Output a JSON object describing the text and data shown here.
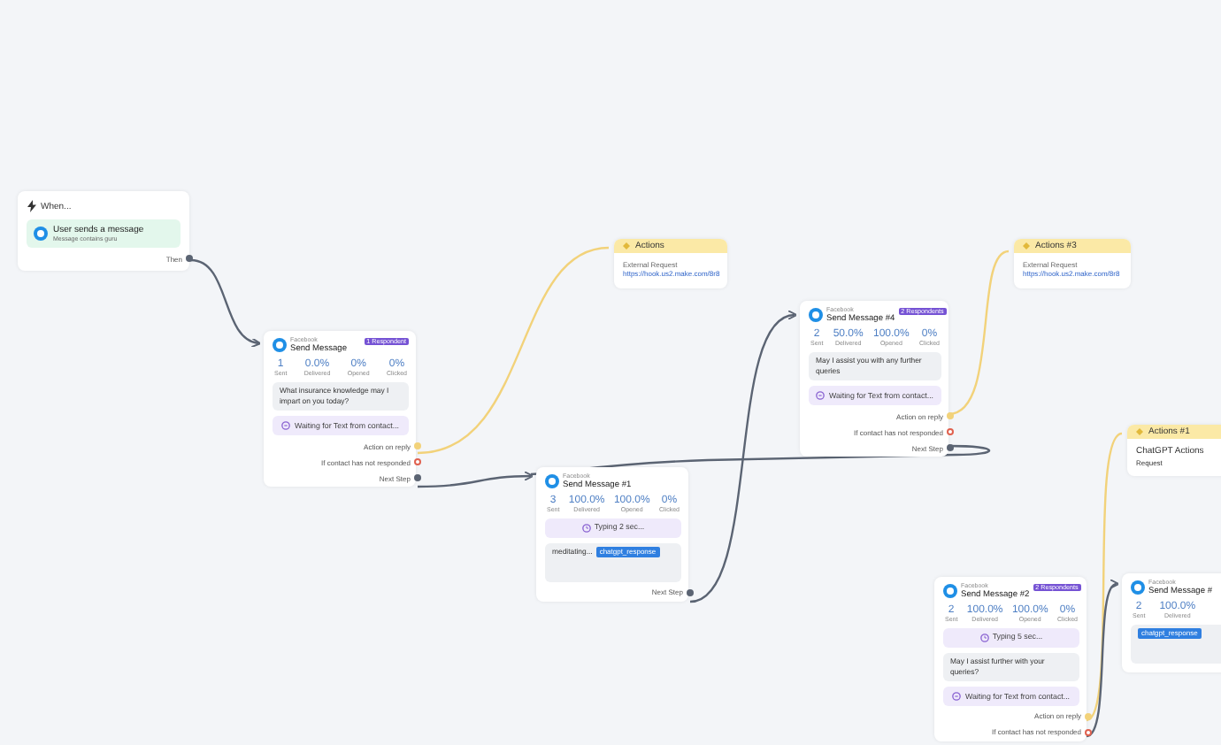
{
  "nodes": [
    {
      "kind": "trigger",
      "title": "When...",
      "trigger": {
        "title": "User sends a message",
        "subtitle": "Message contains guru"
      },
      "ports": [
        {
          "kind": "next",
          "label": "Then"
        }
      ]
    },
    {
      "kind": "message",
      "channel": "Facebook",
      "title": "Send Message",
      "badge": "1 Respondent",
      "stats": [
        {
          "value": "1",
          "label": "Sent"
        },
        {
          "value": "0.0%",
          "label": "Delivered"
        },
        {
          "value": "0%",
          "label": "Opened"
        },
        {
          "value": "0%",
          "label": "Clicked"
        }
      ],
      "blocks": [
        {
          "kind": "text",
          "text": "What insurance knowledge may I impart on you today?"
        },
        {
          "kind": "waiting",
          "text": "Waiting for Text from contact..."
        }
      ],
      "ports": [
        {
          "kind": "reply",
          "label": "Action on reply"
        },
        {
          "kind": "timeout",
          "label": "If contact has not responded"
        },
        {
          "kind": "next",
          "label": "Next Step"
        }
      ]
    },
    {
      "kind": "action",
      "title": "Actions",
      "subtitle": "External Request",
      "detail": "https://hook.us2.make.com/8r8",
      "link": true
    },
    {
      "kind": "message",
      "channel": "Facebook",
      "title": "Send Message #1",
      "stats": [
        {
          "value": "3",
          "label": "Sent"
        },
        {
          "value": "100.0%",
          "label": "Delivered"
        },
        {
          "value": "100.0%",
          "label": "Opened"
        },
        {
          "value": "0%",
          "label": "Clicked"
        }
      ],
      "blocks": [
        {
          "kind": "typing",
          "text": "Typing 2 sec..."
        },
        {
          "kind": "variable",
          "text": "meditating...",
          "tag": "chatgpt_response"
        }
      ],
      "ports": [
        {
          "kind": "next",
          "label": "Next Step"
        }
      ]
    },
    {
      "kind": "message",
      "channel": "Facebook",
      "title": "Send Message #4",
      "badge": "2 Respondents",
      "stats": [
        {
          "value": "2",
          "label": "Sent"
        },
        {
          "value": "50.0%",
          "label": "Delivered"
        },
        {
          "value": "100.0%",
          "label": "Opened"
        },
        {
          "value": "0%",
          "label": "Clicked"
        }
      ],
      "blocks": [
        {
          "kind": "text",
          "text": "May I assist you with any further queries"
        },
        {
          "kind": "waiting",
          "text": "Waiting for Text from contact..."
        }
      ],
      "ports": [
        {
          "kind": "reply",
          "label": "Action on reply"
        },
        {
          "kind": "timeout",
          "label": "If contact has not responded"
        },
        {
          "kind": "next",
          "label": "Next Step"
        }
      ]
    },
    {
      "kind": "action",
      "title": "Actions #3",
      "subtitle": "External Request",
      "detail": "https://hook.us2.make.com/8r8",
      "link": true
    },
    {
      "kind": "action",
      "title": "Actions #1",
      "subtitle": "ChatGPT Actions",
      "detail": "Request",
      "link": false
    },
    {
      "kind": "message",
      "channel": "Facebook",
      "title": "Send Message #2",
      "badge": "2 Respondents",
      "stats": [
        {
          "value": "2",
          "label": "Sent"
        },
        {
          "value": "100.0%",
          "label": "Delivered"
        },
        {
          "value": "100.0%",
          "label": "Opened"
        },
        {
          "value": "0%",
          "label": "Clicked"
        }
      ],
      "blocks": [
        {
          "kind": "typing",
          "text": "Typing 5 sec..."
        },
        {
          "kind": "text",
          "text": "May I assist further with your queries?"
        },
        {
          "kind": "waiting",
          "text": "Waiting for Text from contact..."
        }
      ],
      "ports": [
        {
          "kind": "reply",
          "label": "Action on reply"
        },
        {
          "kind": "timeout",
          "label": "If contact has not responded"
        }
      ]
    },
    {
      "kind": "message",
      "channel": "Facebook",
      "title": "Send Message #",
      "stats": [
        {
          "value": "2",
          "label": "Sent"
        },
        {
          "value": "100.0%",
          "label": "Delivered"
        }
      ],
      "blocks": [
        {
          "kind": "variable",
          "tag": "chatgpt_response"
        }
      ]
    }
  ]
}
